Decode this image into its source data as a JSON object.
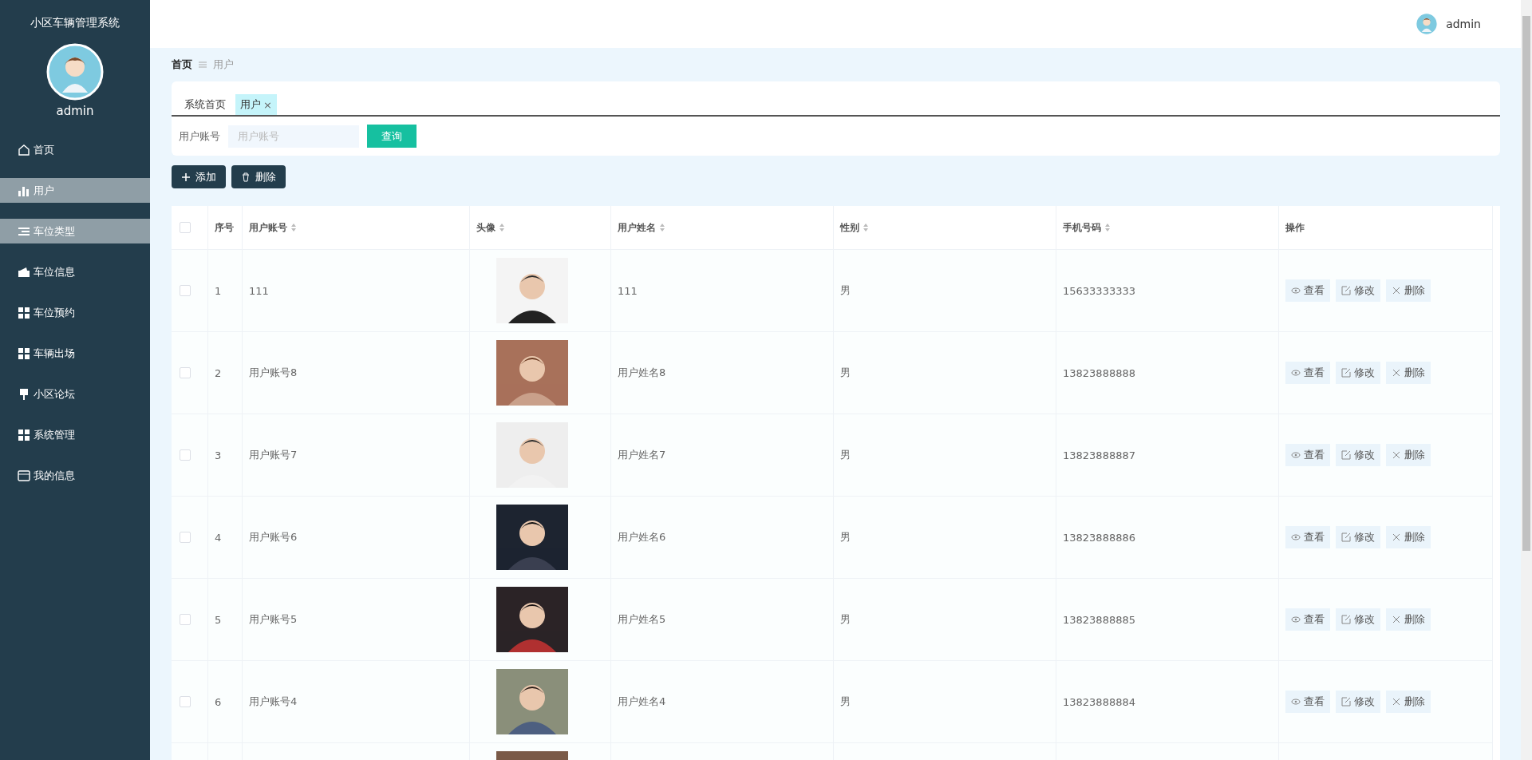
{
  "sidebar": {
    "title": "小区车辆管理系统",
    "user": "admin",
    "items": [
      {
        "label": "首页",
        "kind": "home",
        "highlighted": false
      },
      {
        "label": "用户",
        "kind": "bars",
        "highlighted": true
      },
      {
        "label": "车位类型",
        "kind": "list",
        "highlighted": true
      },
      {
        "label": "车位信息",
        "kind": "wallet",
        "highlighted": false
      },
      {
        "label": "车位预约",
        "kind": "grid",
        "highlighted": false
      },
      {
        "label": "车辆出场",
        "kind": "grid",
        "highlighted": false
      },
      {
        "label": "小区论坛",
        "kind": "brush",
        "highlighted": false
      },
      {
        "label": "系统管理",
        "kind": "grid",
        "highlighted": false
      },
      {
        "label": "我的信息",
        "kind": "card",
        "highlighted": false
      }
    ]
  },
  "header": {
    "user": "admin"
  },
  "breadcrumb": [
    "首页",
    "用户"
  ],
  "tabs": [
    {
      "label": "系统首页",
      "selected": false
    },
    {
      "label": "用户",
      "selected": true,
      "close": "×"
    }
  ],
  "search": {
    "label": "用户账号",
    "placeholder": "用户账号",
    "button": "查询"
  },
  "actions": [
    {
      "label": "添加",
      "kind": "plus"
    },
    {
      "label": "删除",
      "kind": "trash"
    }
  ],
  "table": {
    "select_all": {
      "checked": false
    },
    "columns": [
      {
        "label": "序号",
        "sortable": false
      },
      {
        "label": "用户账号",
        "sortable": true
      },
      {
        "label": "头像",
        "sortable": true
      },
      {
        "label": "用户姓名",
        "sortable": true
      },
      {
        "label": "性别",
        "sortable": true
      },
      {
        "label": "手机号码",
        "sortable": true
      },
      {
        "label": "操作",
        "sortable": false
      }
    ],
    "rows": [
      {
        "checked": false,
        "no": "1",
        "account": "111",
        "avatar": {
          "kind": "picture"
        },
        "name": "111",
        "gender": "男",
        "phone": "15633333333",
        "actions": [
          {
            "label": "查看",
            "kind": "view"
          },
          {
            "label": "修改",
            "kind": "edit"
          },
          {
            "label": "删除",
            "kind": "delete"
          }
        ]
      },
      {
        "checked": false,
        "no": "2",
        "account": "用户账号8",
        "avatar": {
          "kind": "picture"
        },
        "name": "用户姓名8",
        "gender": "男",
        "phone": "13823888888",
        "actions": [
          {
            "label": "查看",
            "kind": "view"
          },
          {
            "label": "修改",
            "kind": "edit"
          },
          {
            "label": "删除",
            "kind": "delete"
          }
        ]
      },
      {
        "checked": false,
        "no": "3",
        "account": "用户账号7",
        "avatar": {
          "kind": "picture"
        },
        "name": "用户姓名7",
        "gender": "男",
        "phone": "13823888887",
        "actions": [
          {
            "label": "查看",
            "kind": "view"
          },
          {
            "label": "修改",
            "kind": "edit"
          },
          {
            "label": "删除",
            "kind": "delete"
          }
        ]
      },
      {
        "checked": false,
        "no": "4",
        "account": "用户账号6",
        "avatar": {
          "kind": "picture"
        },
        "name": "用户姓名6",
        "gender": "男",
        "phone": "13823888886",
        "actions": [
          {
            "label": "查看",
            "kind": "view"
          },
          {
            "label": "修改",
            "kind": "edit"
          },
          {
            "label": "删除",
            "kind": "delete"
          }
        ]
      },
      {
        "checked": false,
        "no": "5",
        "account": "用户账号5",
        "avatar": {
          "kind": "picture"
        },
        "name": "用户姓名5",
        "gender": "男",
        "phone": "13823888885",
        "actions": [
          {
            "label": "查看",
            "kind": "view"
          },
          {
            "label": "修改",
            "kind": "edit"
          },
          {
            "label": "删除",
            "kind": "delete"
          }
        ]
      },
      {
        "checked": false,
        "no": "6",
        "account": "用户账号4",
        "avatar": {
          "kind": "picture"
        },
        "name": "用户姓名4",
        "gender": "男",
        "phone": "13823888884",
        "actions": [
          {
            "label": "查看",
            "kind": "view"
          },
          {
            "label": "修改",
            "kind": "edit"
          },
          {
            "label": "删除",
            "kind": "delete"
          }
        ]
      },
      {
        "avatar": {
          "kind": "picture"
        }
      }
    ]
  }
}
